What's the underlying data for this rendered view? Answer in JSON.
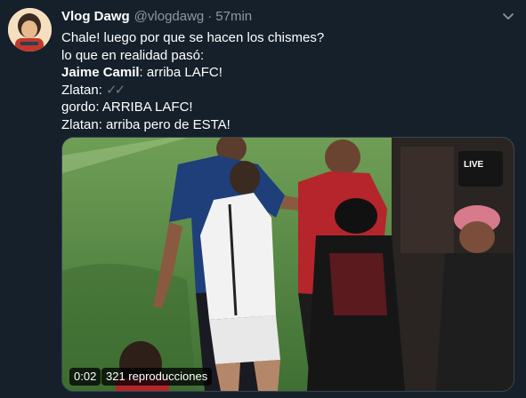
{
  "tweet": {
    "display_name": "Vlog Dawg",
    "handle": "@vlogdawg",
    "separator": "·",
    "time": "57min",
    "text": {
      "l1": "Chale! luego por que se hacen los chismes?",
      "l2": "lo que en realidad pasó:",
      "l3_bold": "Jaime Camil",
      "l3_rest": ": arriba LAFC!",
      "l4": "Zlatan: ",
      "l4_checks": "✓✓",
      "l5": "gordo: ARRIBA LAFC!",
      "l6": "Zlatan: arriba pero de ESTA!"
    }
  },
  "video": {
    "duration": "0:02",
    "views": "321 reproducciones",
    "overlay_logo": "LIVE"
  },
  "icons": {
    "menu": "chevron-down-icon"
  },
  "colors": {
    "background": "#15202b",
    "secondary_text": "#8899a6",
    "field_green": "#4f8440"
  }
}
